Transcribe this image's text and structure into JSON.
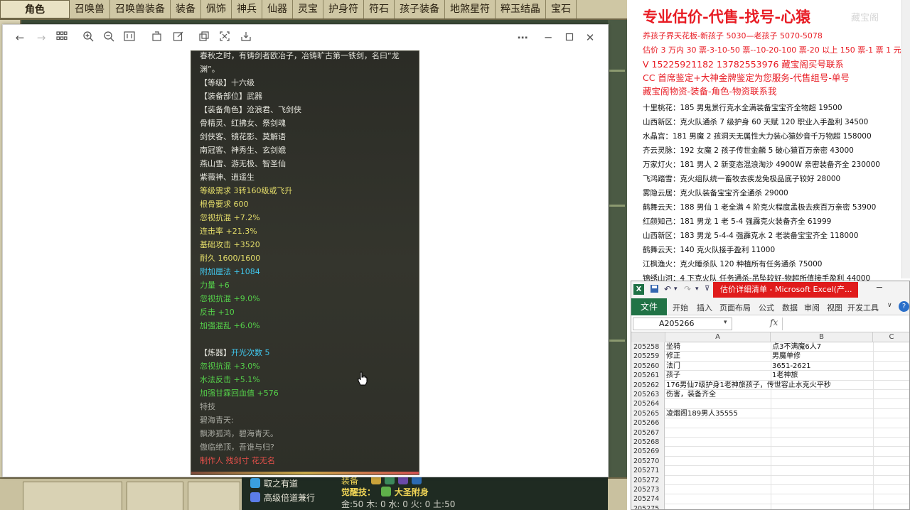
{
  "game": {
    "tabs": [
      "角色",
      "召唤兽",
      "召唤兽装备",
      "装备",
      "佩饰",
      "神兵",
      "仙器",
      "灵宝",
      "护身符",
      "符石",
      "孩子装备",
      "地煞星符",
      "粹玉结晶",
      "宝石"
    ],
    "bottom": {
      "skill_1": "取之有道",
      "skill_2": "高级倍道兼行",
      "equip_label": "装备",
      "awaken_label": "觉醒技：",
      "awaken_value": "大圣附身",
      "elements": "金:50 木: 0 水: 0 火: 0 土:50"
    }
  },
  "viewer": {
    "toolbar_icons": [
      "arrow-left-icon",
      "arrow-right-icon",
      "grid-icon",
      "zoom-in-icon",
      "zoom-out-icon",
      "fit-icon",
      "rotate-icon",
      "edit-icon",
      "copy-icon",
      "crop-icon",
      "save-icon",
      "more-icon",
      "minimize-icon",
      "maximize-icon",
      "close-icon"
    ],
    "tooltip_lines": [
      {
        "text": "春秋之时，有铸剑者欧冶子，冶铸旷古第一铁剑，名曰“龙",
        "color": "white"
      },
      {
        "text": "渊”。",
        "color": "white"
      },
      {
        "text": "【等级】十六级",
        "color": "white"
      },
      {
        "text": "【装备部位】武器",
        "color": "white"
      },
      {
        "text": "【装备角色】沧浪君、飞剑侠",
        "color": "white"
      },
      {
        "text": "骨精灵、红拂女、祭剑魂",
        "color": "white"
      },
      {
        "text": "剑侠客、镜花影、莫解语",
        "color": "white"
      },
      {
        "text": "南冠客、神秀生、玄剑娥",
        "color": "white"
      },
      {
        "text": "燕山雪、游无极、智圣仙",
        "color": "white"
      },
      {
        "text": "紫薇神、逍遥生",
        "color": "white"
      },
      {
        "text": "等级需求 3转160级或飞升",
        "color": "yellow"
      },
      {
        "text": "根骨要求 600",
        "color": "yellow"
      },
      {
        "text": "忽视抗混 +7.2%",
        "color": "yellow"
      },
      {
        "text": "连击率 +21.3%",
        "color": "yellow"
      },
      {
        "text": "基础攻击 +3520",
        "color": "yellow"
      },
      {
        "text": "耐久 1600/1600",
        "color": "yellow"
      },
      {
        "text": "附加厘法 +1084",
        "color": "cyan"
      },
      {
        "text": "力量 +6",
        "color": "green"
      },
      {
        "text": "忽视抗混 +9.0%",
        "color": "green"
      },
      {
        "text": "反击 +10",
        "color": "green"
      },
      {
        "text": "加强混乱 +6.0%",
        "color": "green"
      },
      {
        "text": "",
        "color": "white"
      },
      {
        "text": "【炼器】开光次数 5",
        "color": "white"
      },
      {
        "text": "忽视抗混 +3.0%",
        "color": "green"
      },
      {
        "text": "水法反击 +5.1%",
        "color": "green"
      },
      {
        "text": "加强甘霖回血值 +576",
        "color": "green"
      },
      {
        "text": "特技",
        "color": "gray"
      },
      {
        "text": "碧海青天:",
        "color": "gray"
      },
      {
        "text": "飘渺孤鸿，碧海青天。",
        "color": "gray"
      },
      {
        "text": "傲临绝顶，吾谁与归?",
        "color": "gray"
      },
      {
        "text": "制作人 残剑寸 花无名",
        "color": "red"
      }
    ],
    "tooltip_refine_prefix": "【炼器】",
    "tooltip_refine_value": "开光次数 5"
  },
  "notes": {
    "title": "专业估价-代售-找号-心猿",
    "watermark": "藏宝阁",
    "red_lines": [
      "养孩子界天花板-新孩子 5030—老孩子 5070-5078",
      "估价 3 万内 30 票-3-10-50 票--10-20-100 票-20 以上 150 票-1 票 1 元",
      "V 15225921182      13782553976    藏宝阁买号联系",
      "CC 首席鉴定+大神金牌鉴定为您服务-代售组号-单号",
      "藏宝阁物资-装备-角色-物资联系我"
    ],
    "black_lines": [
      "十里桃花：185 男鬼景行克水全满装备宝宝齐全物超 19500",
      "山西新区：克火队通杀 7 级护身 60 天赋 120 职业入手盈利 34500",
      "水晶宫：181 男魔 2 孩洞天无属性大力装心猿妙音千万物超 158000",
      "齐云灵脉：192 女魔 2 孩子传世金麟 5 破心猿百万亲密 43000",
      "万家灯火：181 男人 2 新变态混浪淘沙 4900W 亲密装备齐全 230000",
      "飞鸿踏雪：克火组队统一畜牧去疾龙免极品底子较好 28000",
      "雾隐云居：克火队装备宝宝齐全通杀 29000",
      "鹤舞云天：188 男仙 1 老全满 4 阶克火程度孟极去疾百万亲密 53900",
      "红颜知己：181 男龙 1 老 5-4 强霹克火装备齐全 61999",
      "山西新区：183 男龙 5-4-4 强霹克水 2 老装备宝宝齐全 118000",
      "鹤舞云天：140 克火队接手盈利 11000",
      "江枫渔火：克火睡杀队 120 种植所有任务通杀 75000",
      "锦绣山河：4 下克火队 任务通杀-吊坠较好-物超所值接手盈利 44000"
    ]
  },
  "excel": {
    "title": "估价详细清单 - Microsoft Excel(产...",
    "file_tab": "文件",
    "menus": [
      "开始",
      "插入",
      "页面布局",
      "公式",
      "数据",
      "审阅",
      "视图",
      "开发工具"
    ],
    "name_box": "A205266",
    "fx_label": "fx",
    "columns": [
      "A",
      "B",
      "C"
    ],
    "rows": [
      {
        "n": "205258",
        "a": "坐骑",
        "b": "点3不满魔6人7"
      },
      {
        "n": "205259",
        "a": "修正",
        "b": "男魔单修"
      },
      {
        "n": "205260",
        "a": "法门",
        "b": "3651-2621"
      },
      {
        "n": "205261",
        "a": "孩子",
        "b": "1老神旅"
      },
      {
        "n": "205262",
        "a": "176男仙7级护身1老神旅孩子，传世容止水克火平秒",
        "b": ""
      },
      {
        "n": "205263",
        "a": "伤害，装备齐全",
        "b": ""
      },
      {
        "n": "205264",
        "a": "",
        "b": ""
      },
      {
        "n": "205265",
        "a": "凌烟阁189男人35555",
        "b": ""
      },
      {
        "n": "205266",
        "a": "",
        "b": ""
      },
      {
        "n": "205267",
        "a": "",
        "b": ""
      },
      {
        "n": "205268",
        "a": "",
        "b": ""
      },
      {
        "n": "205269",
        "a": "",
        "b": ""
      },
      {
        "n": "205270",
        "a": "",
        "b": ""
      },
      {
        "n": "205271",
        "a": "",
        "b": ""
      },
      {
        "n": "205272",
        "a": "",
        "b": ""
      },
      {
        "n": "205273",
        "a": "",
        "b": ""
      },
      {
        "n": "205274",
        "a": "",
        "b": ""
      },
      {
        "n": "205275",
        "a": "",
        "b": ""
      }
    ]
  }
}
